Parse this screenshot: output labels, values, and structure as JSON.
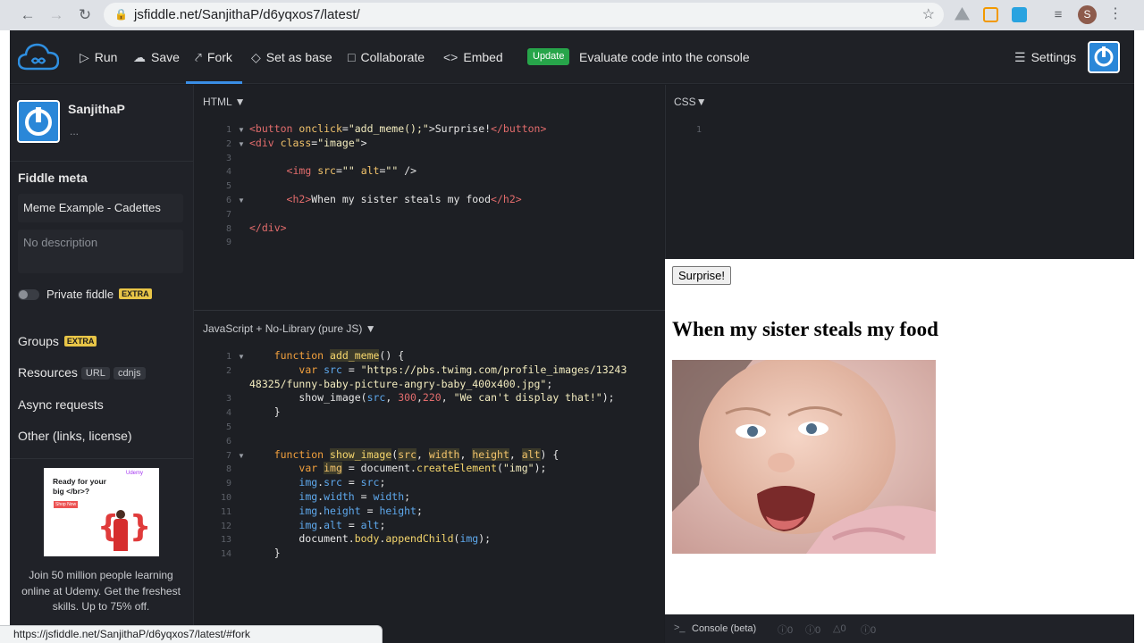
{
  "browser": {
    "url": "jsfiddle.net/SanjithaP/d6yqxos7/latest/",
    "profile_initial": "S",
    "status_url": "https://jsfiddle.net/SanjithaP/d6yqxos7/latest/#fork"
  },
  "toolbar": {
    "run": "Run",
    "save": "Save",
    "fork": "Fork",
    "set_as_base": "Set as base",
    "collaborate": "Collaborate",
    "embed": "Embed",
    "update_badge": "Update",
    "update_text": "Evaluate code into the console",
    "settings": "Settings"
  },
  "sidebar": {
    "username": "SanjithaP",
    "user_more": "...",
    "meta_title": "Fiddle meta",
    "fiddle_name": "Meme Example - Cadettes",
    "description_placeholder": "No description",
    "private_label": "Private fiddle",
    "extra_badge": "EXTRA",
    "groups": "Groups",
    "resources": "Resources",
    "resource_chips": [
      "URL",
      "cdnjs"
    ],
    "async_requests": "Async requests",
    "other": "Other (links, license)",
    "ad_headline": "Ready for your big </br>?",
    "ad_brand": "Udemy",
    "ad_cta": "Shop Now",
    "ad_text": "Join 50 million people learning online at Udemy. Get the freshest skills. Up to 75% off."
  },
  "html_pane": {
    "label": "HTML",
    "line_numbers": [
      "1",
      "2",
      "3",
      "4",
      "5",
      "6",
      "7",
      "8",
      "9"
    ]
  },
  "css_pane": {
    "label": "CSS",
    "line_numbers": [
      "1"
    ]
  },
  "js_pane": {
    "label": "JavaScript + No-Library (pure JS)",
    "line_numbers": [
      "1",
      "2",
      "",
      "3",
      "4",
      "5",
      "6",
      "7",
      "8",
      "9",
      "10",
      "11",
      "12",
      "13",
      "14"
    ]
  },
  "result": {
    "button_label": "Surprise!",
    "heading": "When my sister steals my food"
  },
  "console": {
    "label": "Console (beta)",
    "counts": [
      "0",
      "0",
      "0",
      "0"
    ]
  }
}
